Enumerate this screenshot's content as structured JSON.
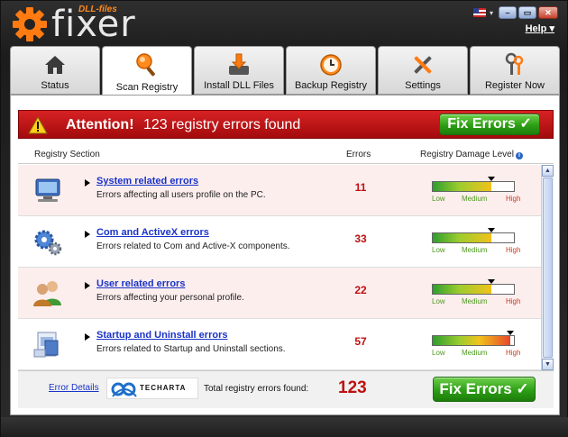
{
  "app": {
    "logo_small": "DLL-files",
    "logo_text": "fixer",
    "help_label": "Help",
    "help_caret": "▾",
    "flag_caret": "▾",
    "win_minimize": "–",
    "win_restore": "▭",
    "win_close": "✕"
  },
  "tabs": [
    {
      "label": "Status",
      "icon": "home-icon",
      "active": false
    },
    {
      "label": "Scan Registry",
      "icon": "magnifier-icon",
      "active": true
    },
    {
      "label": "Install DLL Files",
      "icon": "download-icon",
      "active": false
    },
    {
      "label": "Backup Registry",
      "icon": "clock-backup-icon",
      "active": false
    },
    {
      "label": "Settings",
      "icon": "tools-icon",
      "active": false
    },
    {
      "label": "Register Now",
      "icon": "keys-icon",
      "active": false
    }
  ],
  "alert": {
    "title": "Attention!",
    "message": "123 registry errors found",
    "fix_button": "Fix Errors ✓"
  },
  "table": {
    "col_section": "Registry Section",
    "col_errors": "Errors",
    "col_level": "Registry Damage Level",
    "level_labels": {
      "low": "Low",
      "medium": "Medium",
      "high": "High"
    },
    "rows": [
      {
        "title": "System related errors",
        "desc": "Errors affecting all users profile on the PC.",
        "errors": "11",
        "damage_level": 0.72,
        "icon": "computer-icon"
      },
      {
        "title": "Com and ActiveX errors",
        "desc": "Errors related to Com and Active-X components.",
        "errors": "33",
        "damage_level": 0.72,
        "icon": "gears-icon"
      },
      {
        "title": "User related errors",
        "desc": "Errors affecting your personal profile.",
        "errors": "22",
        "damage_level": 0.72,
        "icon": "users-icon"
      },
      {
        "title": "Startup and Uninstall errors",
        "desc": "Errors related to Startup and Uninstall sections.",
        "errors": "57",
        "damage_level": 0.95,
        "icon": "installer-icon"
      }
    ]
  },
  "footer": {
    "error_details": "Error Details",
    "logo_text": "TECHARTA",
    "total_label": "Total registry errors found:",
    "total_value": "123",
    "fix_button": "Fix Errors ✓"
  },
  "colors": {
    "alert_red": "#c41416",
    "fix_green": "#2d9e16",
    "count_red": "#c01010",
    "link_blue": "#1a33c8"
  }
}
